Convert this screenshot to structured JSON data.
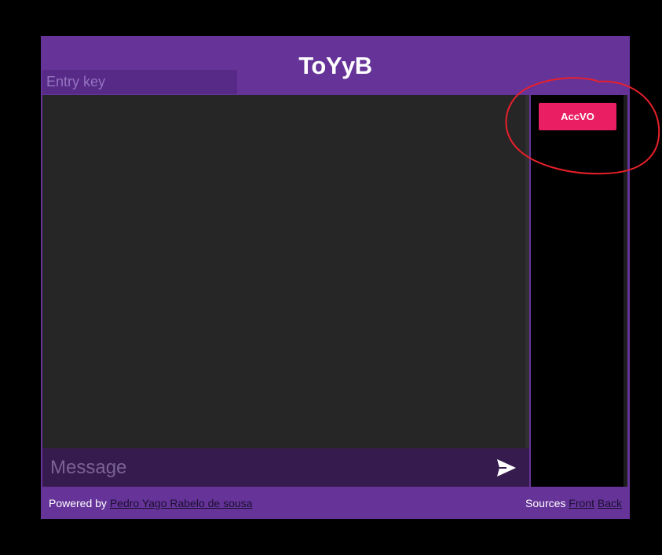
{
  "header": {
    "title": "ToYyB",
    "entry_key_placeholder": "Entry key"
  },
  "composer": {
    "message_placeholder": "Message",
    "send_icon": "send-icon"
  },
  "side_panel": {
    "button_label": "AccVO"
  },
  "footer": {
    "powered_by_label": "Powered by",
    "author_link": "Pedro Yago Rabelo de sousa",
    "sources_label": "Sources",
    "front_link": "Front",
    "back_link": "Back"
  },
  "colors": {
    "primary": "#663399",
    "chat_background": "#262626",
    "composer_background": "#351b4e",
    "accent_button": "#e91e63",
    "annotation_circle": "#e8202a"
  }
}
